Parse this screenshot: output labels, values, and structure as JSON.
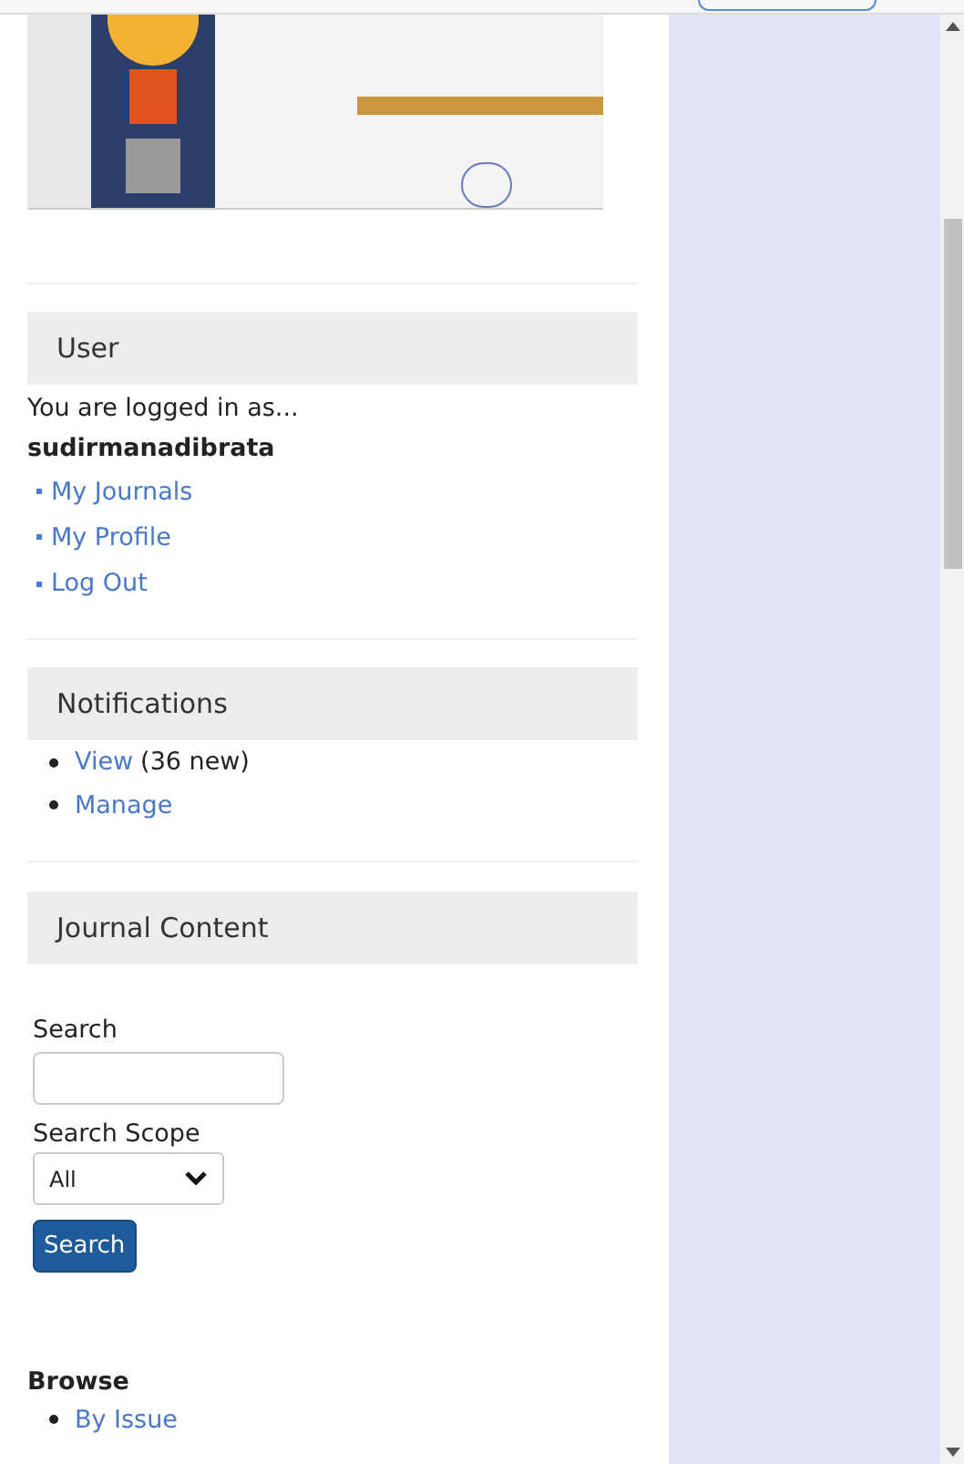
{
  "user_block": {
    "title": "User",
    "logged_in_text": "You are logged in as...",
    "username": "sudirmanadibrata",
    "links": [
      "My Journals",
      "My Profile",
      "Log Out"
    ]
  },
  "notifications_block": {
    "title": "Notifications",
    "items": [
      {
        "link": "View",
        "note": "(36 new)"
      },
      {
        "link": "Manage"
      }
    ]
  },
  "journal_content_block": {
    "title": "Journal Content",
    "search_label": "Search",
    "scope_label": "Search Scope",
    "scope_value": "All",
    "search_button": "Search",
    "browse_heading": "Browse",
    "browse_items": [
      "By Issue"
    ]
  }
}
